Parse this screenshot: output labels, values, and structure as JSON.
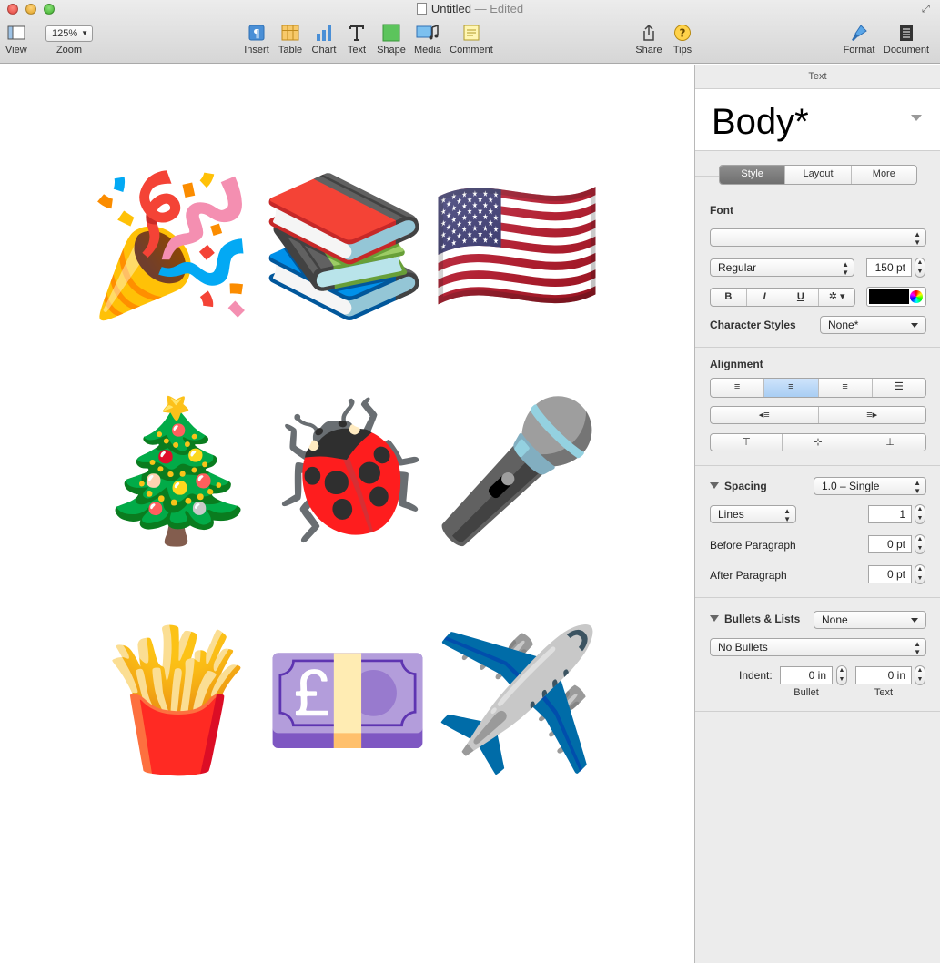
{
  "window": {
    "title": "Untitled",
    "status": "— Edited"
  },
  "toolbar": {
    "view_label": "View",
    "zoom_value": "125%",
    "zoom_label": "Zoom",
    "insert_label": "Insert",
    "table_label": "Table",
    "chart_label": "Chart",
    "text_label": "Text",
    "shape_label": "Shape",
    "media_label": "Media",
    "comment_label": "Comment",
    "share_label": "Share",
    "tips_label": "Tips",
    "format_label": "Format",
    "document_label": "Document"
  },
  "canvas": {
    "emojis": [
      {
        "char": "🎉",
        "name": "party-popper"
      },
      {
        "char": "📚",
        "name": "books"
      },
      {
        "char": "🇺🇸",
        "name": "us-flag"
      },
      {
        "char": "🎄",
        "name": "christmas-tree"
      },
      {
        "char": "🐞",
        "name": "ladybug"
      },
      {
        "char": "🎤",
        "name": "microphone"
      },
      {
        "char": "🍟",
        "name": "french-fries"
      },
      {
        "char": "💷",
        "name": "pound-banknote"
      },
      {
        "char": "✈️",
        "name": "airplane"
      }
    ]
  },
  "inspector": {
    "header": "Text",
    "style_name": "Body*",
    "tabs": [
      "Style",
      "Layout",
      "More"
    ],
    "font_label": "Font",
    "font_family": "",
    "font_weight": "Regular",
    "font_size": "150 pt",
    "bold": "B",
    "italic": "I",
    "underline": "U",
    "gear": "✲",
    "text_color": "#000000",
    "character_styles_label": "Character Styles",
    "character_styles_value": "None*",
    "alignment_label": "Alignment",
    "spacing_label": "Spacing",
    "spacing_value": "1.0 – Single",
    "lines_value": "Lines",
    "lines_number": "1",
    "before_paragraph_label": "Before Paragraph",
    "before_paragraph_value": "0 pt",
    "after_paragraph_label": "After Paragraph",
    "after_paragraph_value": "0 pt",
    "bullets_label": "Bullets & Lists",
    "bullets_value": "None",
    "bullets_type": "No Bullets",
    "indent_label": "Indent:",
    "indent_bullet_value": "0 in",
    "indent_text_value": "0 in",
    "indent_bullet_label": "Bullet",
    "indent_text_label": "Text"
  }
}
